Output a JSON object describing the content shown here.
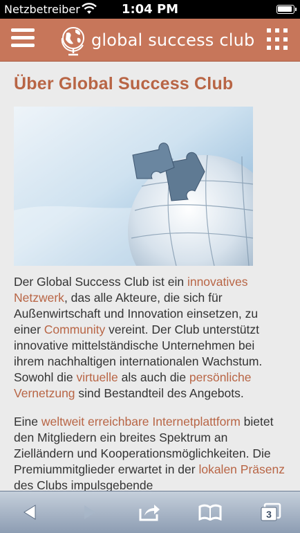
{
  "status_bar": {
    "carrier": "Netzbetreiber",
    "time": "1:04 PM"
  },
  "header": {
    "logo_text": "global success club"
  },
  "page": {
    "title": "Über Global Success Club",
    "p1": {
      "t1": "Der Global Success Club ist ein ",
      "l1": "innovatives Netzwerk",
      "t2": ", das alle Akteure, die sich für Außenwirtschaft und Innovation einsetzen, zu einer ",
      "l2": "Community",
      "t3": " vereint. Der Club unterstützt innovative mittelständische Unternehmen bei ihrem nachhaltigen internationalen Wachstum. Sowohl die ",
      "l3": "virtuelle",
      "t4": " als auch die ",
      "l4": "persönliche Vernetzung",
      "t5": " sind Bestandteil des Angebots."
    },
    "p2": {
      "t1": "Eine ",
      "l1": "weltweit erreichbare Internetplattform",
      "t2": " bietet den Mitgliedern ein breites Spektrum an Zielländern und Kooperationsmöglichkeiten. Die Premiummitglieder erwartet in der ",
      "l2": "lokalen Präsenz",
      "t3": " des Clubs impulsgebende"
    }
  },
  "toolbar": {
    "tabs_count": "3",
    "icons": [
      "back-icon",
      "forward-icon",
      "share-icon",
      "bookmarks-icon",
      "tabs-icon"
    ]
  },
  "colors": {
    "header": "#c7765a",
    "accent": "#b86545",
    "text": "#333333",
    "background": "#ebebeb"
  }
}
